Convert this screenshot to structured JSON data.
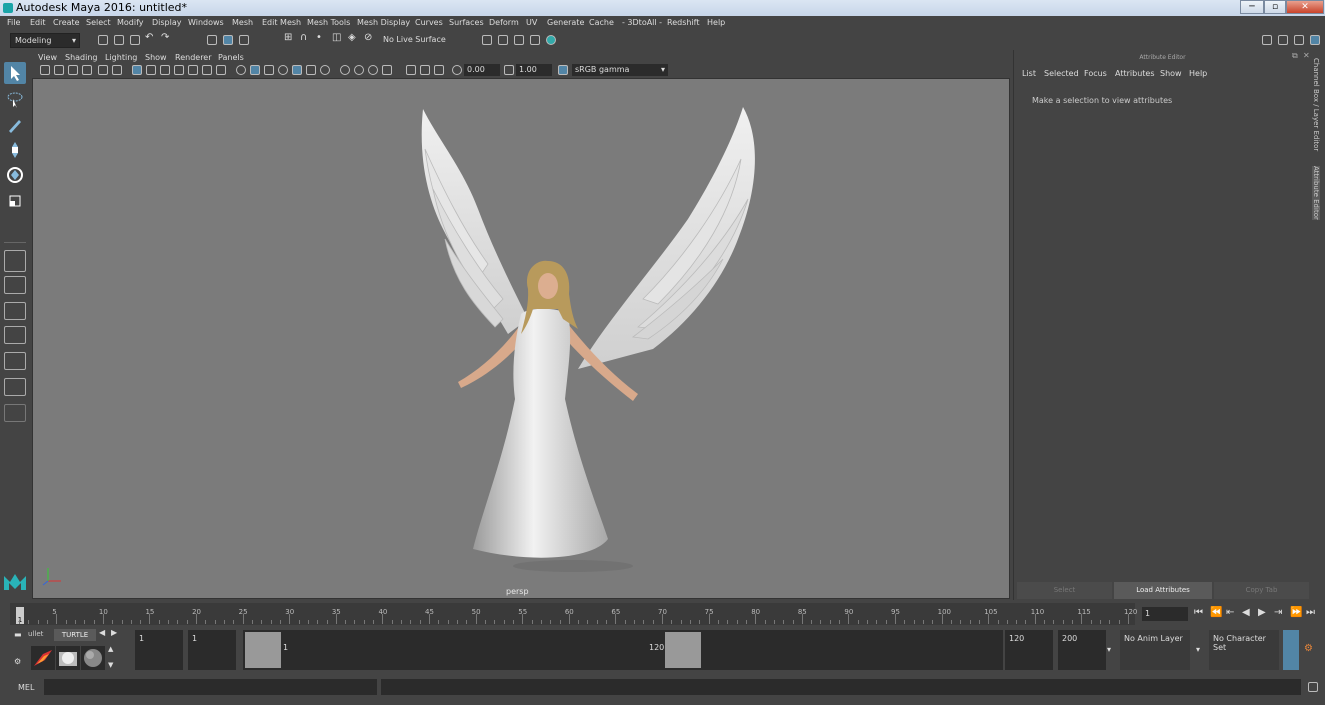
{
  "window": {
    "title": "Autodesk Maya 2016: untitled*",
    "min": "─",
    "max": "▫",
    "close": "✕"
  },
  "menubar": {
    "items": [
      "File",
      "Edit",
      "Create",
      "Select",
      "Modify",
      "Display",
      "Windows",
      "Mesh",
      "Edit Mesh",
      "Mesh Tools",
      "Mesh Display",
      "Curves",
      "Surfaces",
      "Deform",
      "UV",
      "Generate",
      "Cache",
      "- 3DtoAll -",
      "Redshift",
      "Help"
    ]
  },
  "shelf": {
    "mode": "Modeling",
    "live_surface": "No Live Surface"
  },
  "viewport": {
    "menu": [
      "View",
      "Shading",
      "Lighting",
      "Show",
      "Renderer",
      "Panels"
    ],
    "exposure": "0.00",
    "gamma": "1.00",
    "colorspace": "sRGB gamma",
    "camera_label": "persp"
  },
  "attribute_editor": {
    "header": "Attribute Editor",
    "menu": [
      "List",
      "Selected",
      "Focus",
      "Attributes",
      "Show",
      "Help"
    ],
    "message": "Make a selection to view attributes",
    "buttons": {
      "select": "Select",
      "load": "Load Attributes",
      "copy": "Copy Tab"
    },
    "side_tabs": {
      "channel": "Channel Box / Layer Editor",
      "attr": "Attribute Editor"
    }
  },
  "timeline": {
    "ticks": [
      "5",
      "10",
      "15",
      "20",
      "25",
      "30",
      "35",
      "40",
      "45",
      "50",
      "55",
      "60",
      "65",
      "70",
      "75",
      "80",
      "85",
      "90",
      "95",
      "100",
      "105",
      "110",
      "115",
      "120"
    ],
    "current_frame_marker": "1",
    "current_frame_field": "1"
  },
  "range": {
    "shelf_tab_left": "ullet",
    "shelf_tab_right": "TURTLE",
    "start_field": "1",
    "playback_start": "1",
    "slider_start": "1",
    "slider_end": "120",
    "playback_end": "120",
    "end_field": "200",
    "anim_layer": "No Anim Layer",
    "character_set": "No Character Set"
  },
  "cmdline": {
    "label": "MEL"
  },
  "colors": {
    "accent": "#5285a6",
    "viewport_bg": "#7b7b7b",
    "ui_bg": "#444444"
  }
}
